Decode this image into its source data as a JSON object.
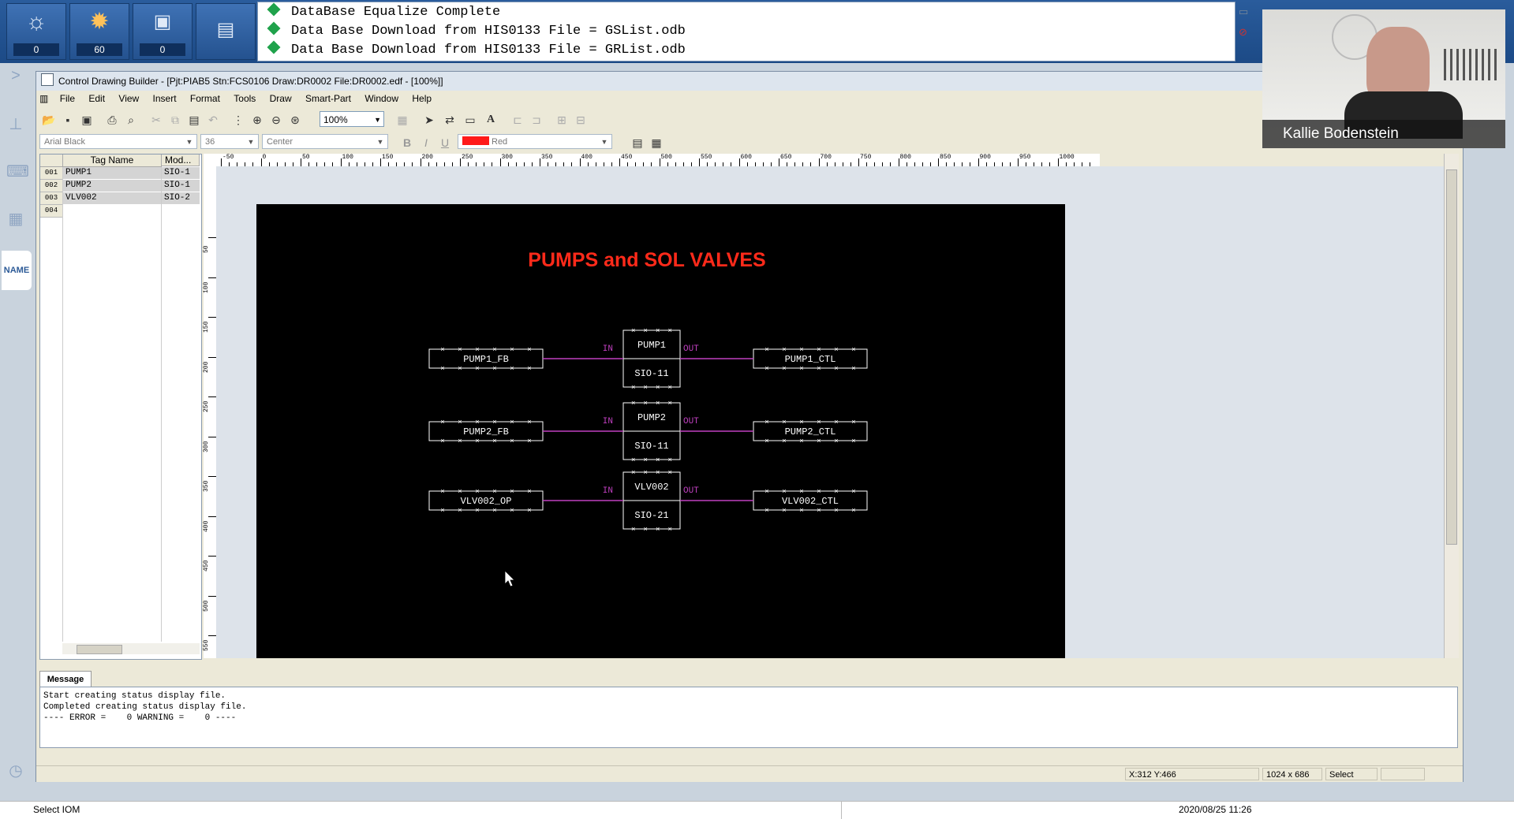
{
  "alarm_bar": {
    "buttons": [
      {
        "icon": "lightbulb-icon",
        "count": "0"
      },
      {
        "icon": "sun-icon",
        "count": "60"
      },
      {
        "icon": "operator-guide-icon",
        "count": "0"
      },
      {
        "icon": "message-monitor-icon"
      }
    ],
    "messages": [
      "DataBase Equalize Complete",
      "Data Base Download from HIS0133 File = GSList.odb",
      "Data Base Download from HIS0133 File = GRList.odb"
    ]
  },
  "rail": {
    "name_label": "NAME"
  },
  "window": {
    "title": "Control Drawing Builder - [Pjt:PIAB5 Stn:FCS0106 Draw:DR0002 File:DR0002.edf - [100%]]",
    "menus": [
      "File",
      "Edit",
      "View",
      "Insert",
      "Format",
      "Tools",
      "Draw",
      "Smart-Part",
      "Window",
      "Help"
    ],
    "zoom": "100%",
    "font_name": "Arial Black",
    "font_size": "36",
    "align": "Center",
    "color_name": "Red",
    "color_hex": "#ff1a1a"
  },
  "taglist": {
    "headers": [
      "Tag Name",
      "Mod..."
    ],
    "rows": [
      {
        "num": "001",
        "tag": "PUMP1",
        "mod": "SIO-1"
      },
      {
        "num": "002",
        "tag": "PUMP2",
        "mod": "SIO-1"
      },
      {
        "num": "003",
        "tag": "VLV002",
        "mod": "SIO-2"
      },
      {
        "num": "004",
        "tag": "",
        "mod": ""
      }
    ]
  },
  "ruler": {
    "top_labels": [
      "-50",
      "0",
      "50",
      "100",
      "150",
      "200",
      "250",
      "300",
      "350",
      "400",
      "450",
      "500",
      "550",
      "600",
      "650",
      "700",
      "750",
      "800",
      "850",
      "900",
      "950",
      "1000"
    ],
    "left_labels": [
      "50",
      "100",
      "150",
      "200",
      "250",
      "300",
      "350",
      "400",
      "450",
      "500",
      "550"
    ]
  },
  "drawing": {
    "title": "PUMPS and SOL VALVES",
    "title_color": "#ff2a1a",
    "line_color": "#c040c0",
    "box_color": "#ffffff",
    "in_label": "IN",
    "out_label": "OUT",
    "loops": [
      {
        "input": "PUMP1_FB",
        "block_tag": "PUMP1",
        "block_type": "SIO-11",
        "output": "PUMP1_CTL"
      },
      {
        "input": "PUMP2_FB",
        "block_tag": "PUMP2",
        "block_type": "SIO-11",
        "output": "PUMP2_CTL"
      },
      {
        "input": "VLV002_OP",
        "block_tag": "VLV002",
        "block_type": "SIO-21",
        "output": "VLV002_CTL"
      }
    ]
  },
  "message_pane": {
    "tab": "Message",
    "lines": [
      "Start creating status display file.",
      "Completed creating status display file.",
      "---- ERROR =    0 WARNING =    0 ----"
    ]
  },
  "statusbar": {
    "coords": "X:312  Y:466",
    "size": "1024 x 686",
    "mode": "Select"
  },
  "os_bar": {
    "left_text": "Select IOM",
    "datetime": "2020/08/25 11:26"
  },
  "video": {
    "participant": "Kallie Bodenstein"
  }
}
